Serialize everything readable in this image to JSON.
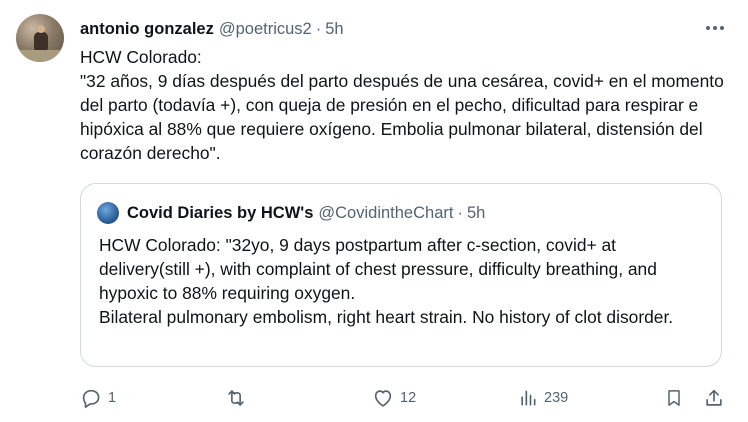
{
  "tweet": {
    "author_name": "antonio gonzalez",
    "author_handle": "@poetricus2",
    "separator": "·",
    "time": "5h",
    "text": "HCW Colorado:\n\"32 años, 9 días después del parto después de una cesárea, covid+ en el momento del parto (todavía +), con queja de presión en el pecho, dificultad para respirar e hipóxica al 88% que requiere oxígeno. Embolia pulmonar bilateral, distensión del corazón derecho\".",
    "more_icon": "more-dots-icon"
  },
  "quote": {
    "author_name": "Covid Diaries by HCW's",
    "author_handle": "@CovidintheChart",
    "separator": "·",
    "time": "5h",
    "text": "HCW Colorado: \"32yo, 9 days postpartum after c-section, covid+ at delivery(still +), with complaint of chest pressure, difficulty breathing, and hypoxic to 88% requiring oxygen.\nBilateral pulmonary embolism, right heart strain. No history of clot disorder."
  },
  "actions": {
    "reply_count": "1",
    "retweet_count": "",
    "like_count": "12",
    "views_count": "239",
    "icons": [
      "reply-icon",
      "retweet-icon",
      "like-icon",
      "views-icon",
      "bookmark-icon",
      "share-icon"
    ]
  },
  "colors": {
    "text": "#0f1419",
    "secondary": "#536471",
    "border": "#cfd9de"
  }
}
